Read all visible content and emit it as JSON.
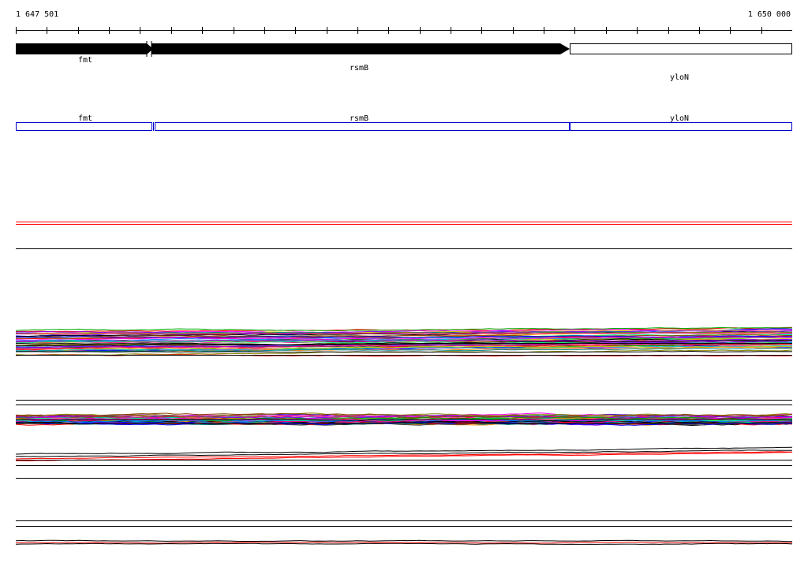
{
  "ruler": {
    "start_label": "1 647 501",
    "end_label": "1 650 000"
  },
  "genes": [
    {
      "name": "fmt",
      "strand": "+",
      "fill": "black"
    },
    {
      "name": "rsmB",
      "strand": "+",
      "fill": "black"
    },
    {
      "name": "yloN",
      "strand": "+",
      "fill": "white"
    }
  ],
  "annotation_track": {
    "color": "#0000cc",
    "labels": [
      "fmt",
      "rsmB",
      "yloN"
    ]
  },
  "colors": {
    "line": "#000000",
    "accent": "#ff0000",
    "track_border": "#0000cc"
  },
  "palette": [
    "#ff0000",
    "#00aa00",
    "#0000ff",
    "#ff00ff",
    "#00cccc",
    "#cccc00",
    "#000000",
    "#ff8800",
    "#8800ff",
    "#008888",
    "#888800",
    "#ff0088",
    "#0088ff",
    "#00ff88",
    "#884400",
    "#444444"
  ]
}
